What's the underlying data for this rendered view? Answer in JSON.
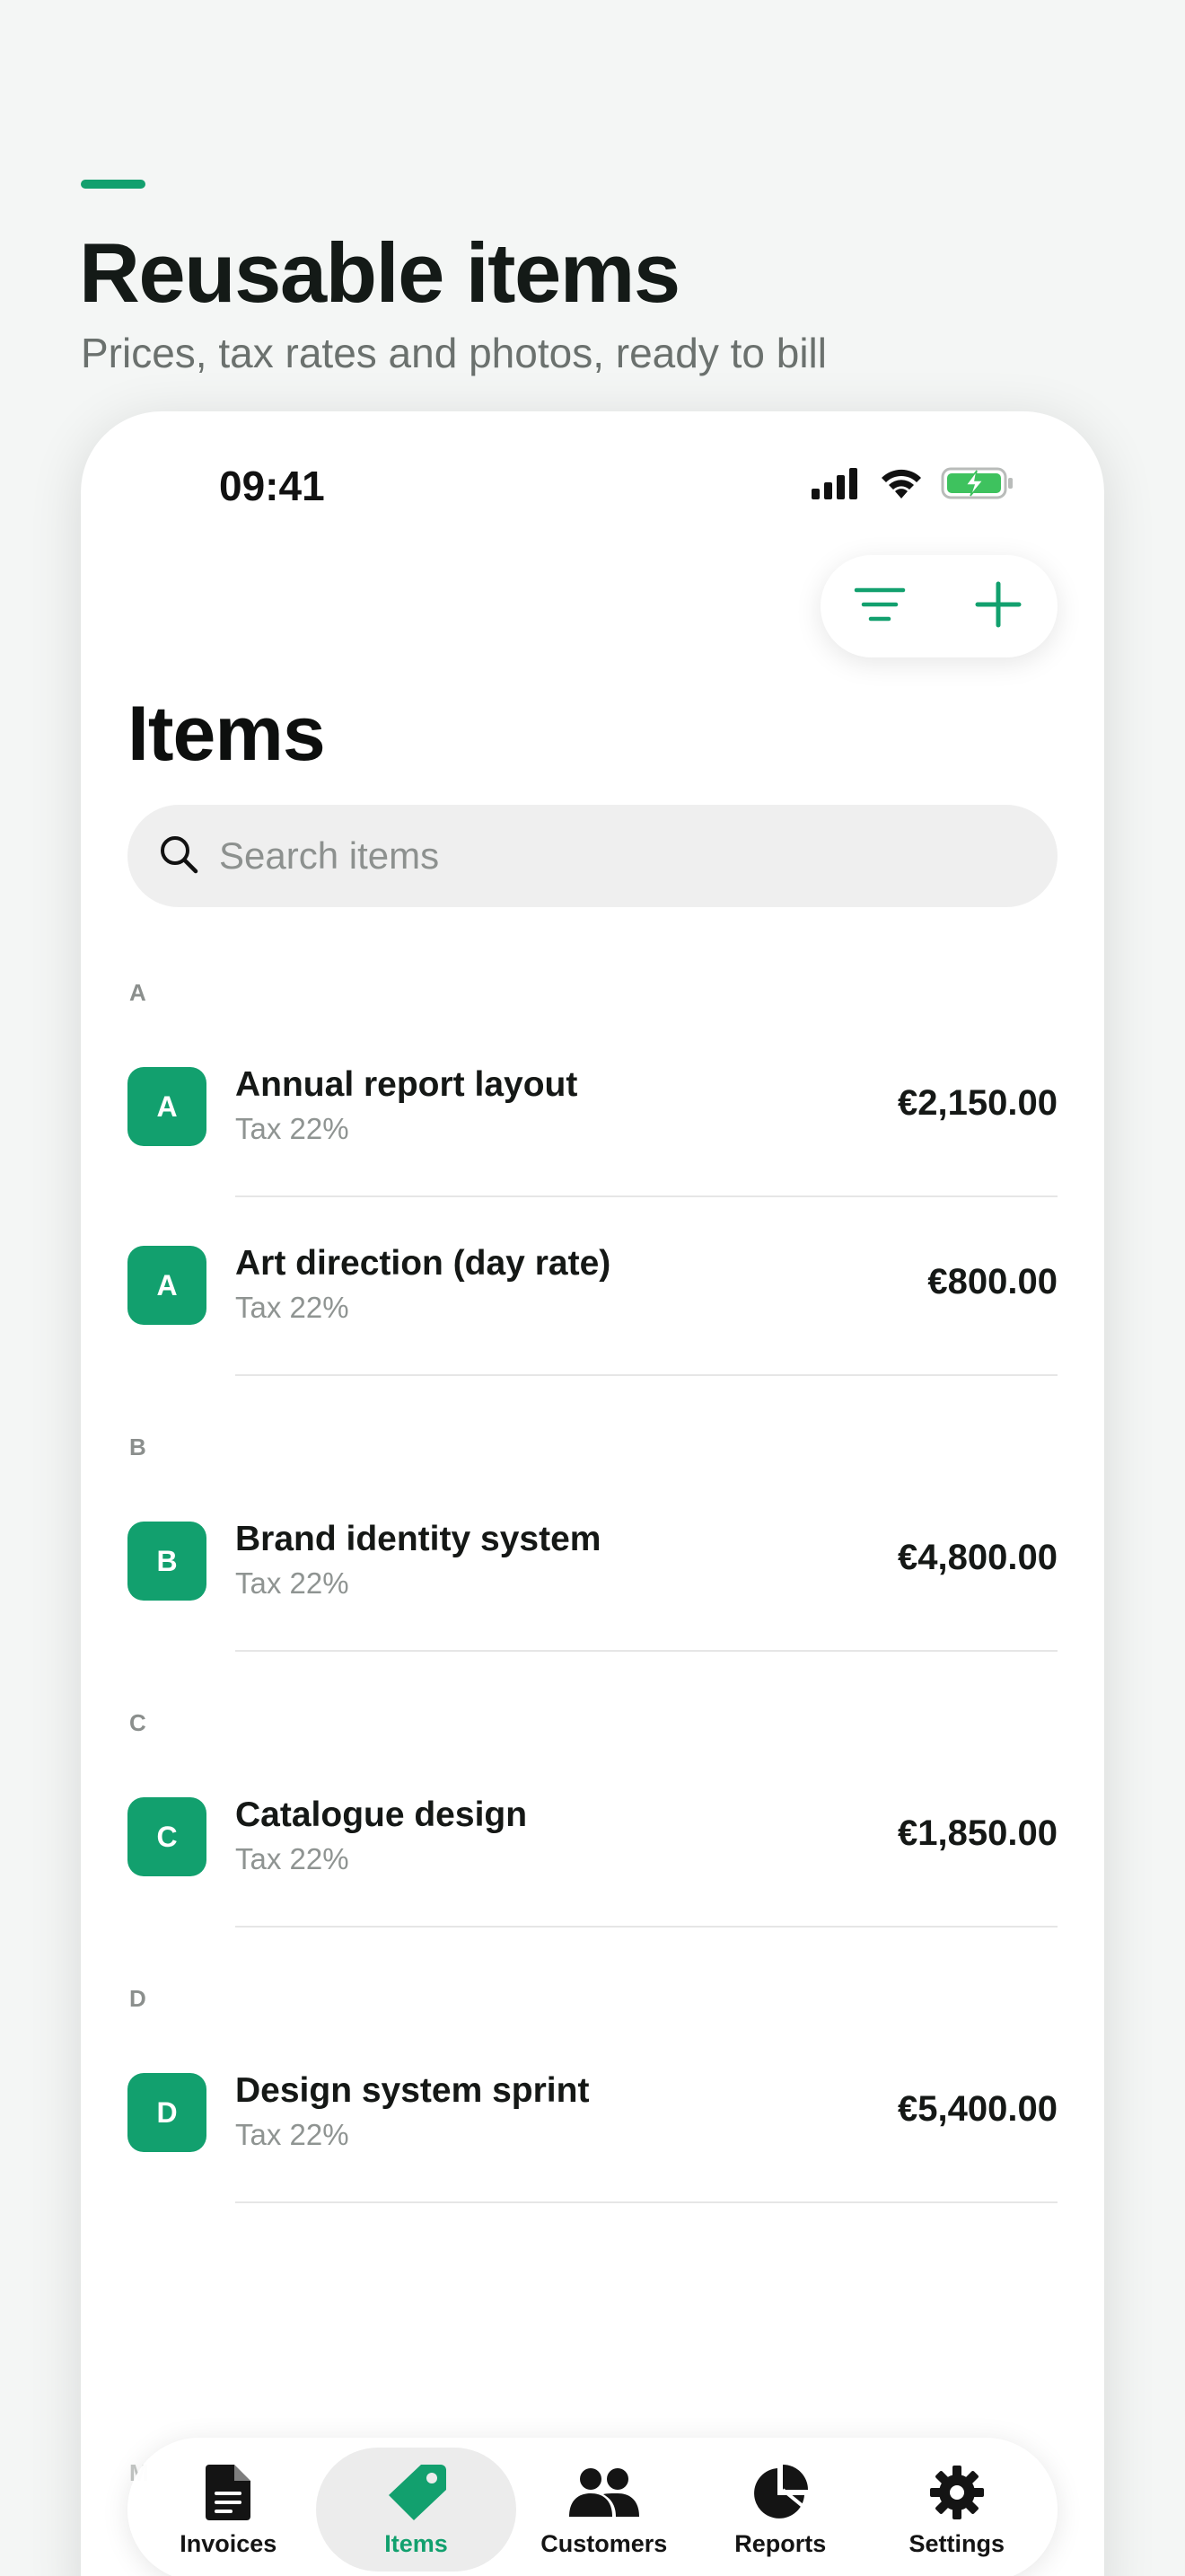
{
  "hero": {
    "title": "Reusable items",
    "subtitle": "Prices, tax rates and photos, ready to bill"
  },
  "status_bar": {
    "time": "09:41",
    "icons": [
      "cellular-signal-icon",
      "wifi-icon",
      "battery-charging-icon"
    ]
  },
  "toolbar": {
    "filter_icon": "filter-lines-icon",
    "add_icon": "plus-icon"
  },
  "page": {
    "title": "Items"
  },
  "search": {
    "placeholder": "Search items"
  },
  "sections": [
    {
      "letter": "A",
      "items": [
        {
          "initial": "A",
          "name": "Annual report layout",
          "tax": "Tax 22%",
          "price": "€2,150.00"
        },
        {
          "initial": "A",
          "name": "Art direction (day rate)",
          "tax": "Tax 22%",
          "price": "€800.00"
        }
      ]
    },
    {
      "letter": "B",
      "items": [
        {
          "initial": "B",
          "name": "Brand identity system",
          "tax": "Tax 22%",
          "price": "€4,800.00"
        }
      ]
    },
    {
      "letter": "C",
      "items": [
        {
          "initial": "C",
          "name": "Catalogue design",
          "tax": "Tax 22%",
          "price": "€1,850.00"
        }
      ]
    },
    {
      "letter": "D",
      "items": [
        {
          "initial": "D",
          "name": "Design system sprint",
          "tax": "Tax 22%",
          "price": "€5,400.00"
        }
      ]
    }
  ],
  "peek_section_letter": "M",
  "tabbar": {
    "tabs": [
      {
        "label": "Invoices",
        "icon": "document-icon",
        "active": false
      },
      {
        "label": "Items",
        "icon": "tag-icon",
        "active": true
      },
      {
        "label": "Customers",
        "icon": "people-icon",
        "active": false
      },
      {
        "label": "Reports",
        "icon": "pie-chart-icon",
        "active": false
      },
      {
        "label": "Settings",
        "icon": "gear-icon",
        "active": false
      }
    ]
  },
  "colors": {
    "accent": "#12a06e",
    "background": "#f4f6f5",
    "text_primary": "#141a17",
    "text_secondary": "#8f9492"
  }
}
